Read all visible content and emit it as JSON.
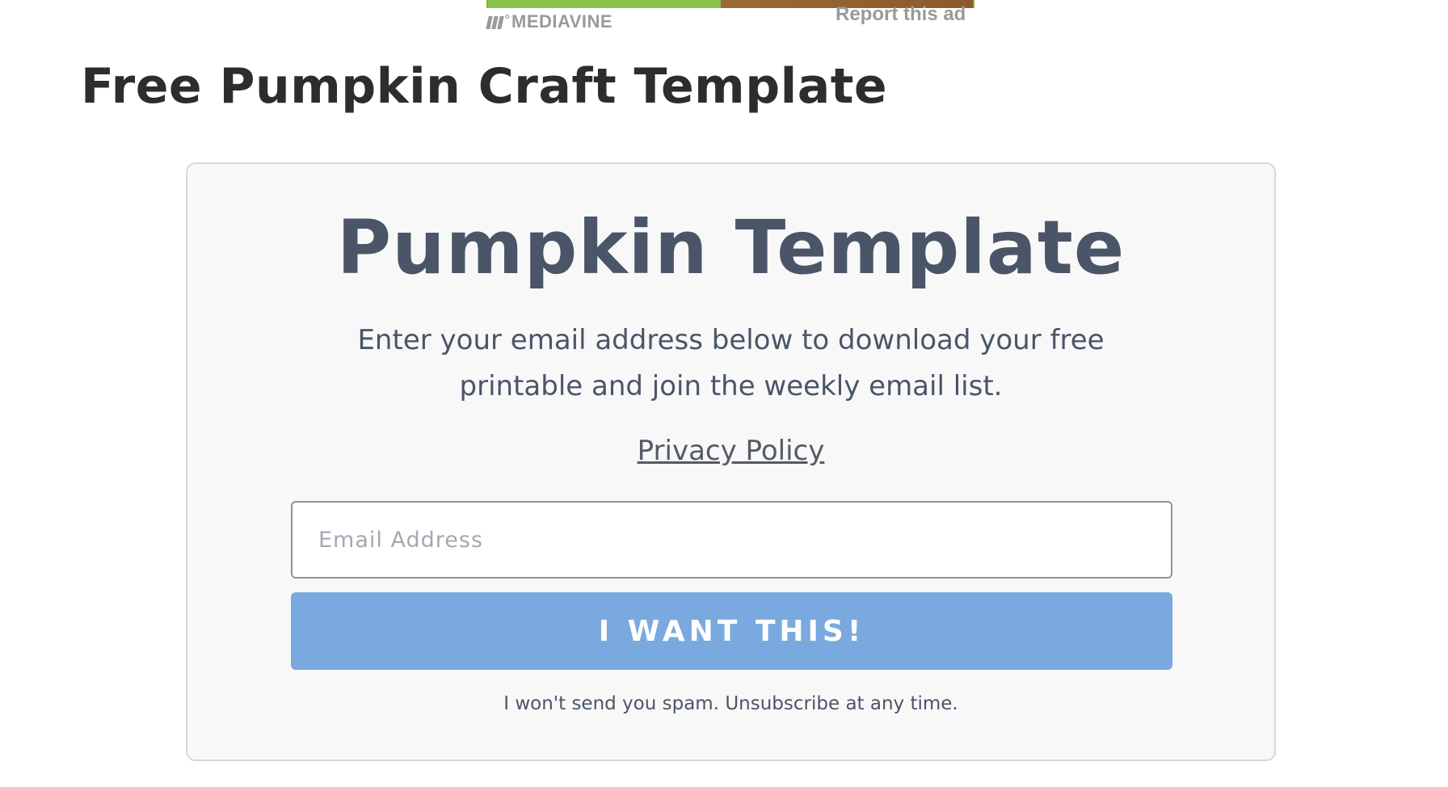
{
  "ad": {
    "brand_label": "MEDIAVINE",
    "brand_icon": "mediavine-logo-icon",
    "report_label": "Report this ad"
  },
  "page": {
    "title": "Free Pumpkin Craft Template"
  },
  "optin": {
    "heading": "Pumpkin Template",
    "description": "Enter your email address below to download your free printable and join the weekly email list.",
    "privacy_label": "Privacy Policy ",
    "email_placeholder": "Email Address",
    "email_value": "",
    "submit_label": "I WANT THIS!",
    "spam_note": "I won't send you spam. Unsubscribe at any time."
  },
  "colors": {
    "heading": "#2d2d2d",
    "card_text": "#4a5568",
    "card_background": "#f8f8f8",
    "card_border": "#d4d8e0",
    "button_background": "#79a9df",
    "button_text": "#ffffff",
    "ad_meta": "#9a9a9a"
  }
}
